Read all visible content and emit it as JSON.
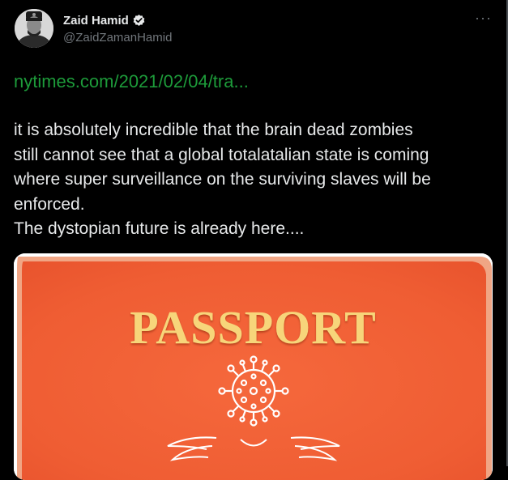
{
  "tweet": {
    "author_name": "Zaid Hamid",
    "author_handle": "@ZaidZamanHamid",
    "more_label": "···",
    "link_text": "nytimes.com/2021/02/04/tra...",
    "body_text": "it is absolutely incredible that the brain dead zombies\nstill cannot see that a global totalatalian state is coming\nwhere super surveillance on the surviving slaves will be\nenforced.\nThe dystopian future is already here....",
    "link_color": "#1d9b3a",
    "verified_color": "#e7e9ea"
  },
  "media": {
    "passport_word": "PASSPORT",
    "cover_color": "#f26a3a",
    "emblem_color": "#ffffff",
    "title_color": "#f7d57a"
  },
  "icons": {
    "avatar": "profile-photo",
    "verified": "verified-badge-icon",
    "more": "more-options-icon",
    "emblem": "virus-icon"
  }
}
